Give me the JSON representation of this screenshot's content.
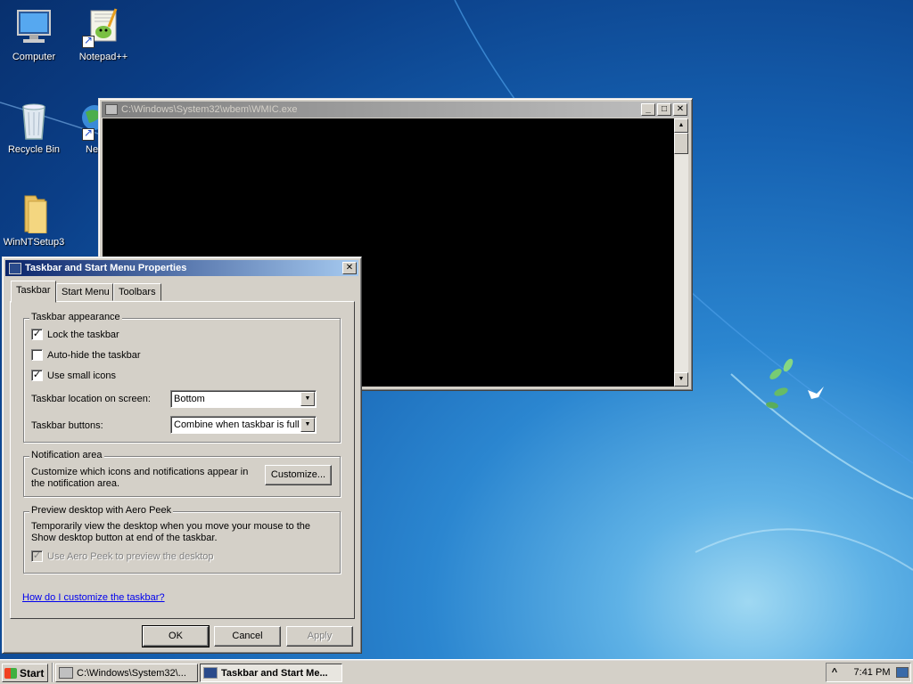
{
  "desktop": {
    "icons": [
      {
        "label": "Computer",
        "icon": "computer-icon"
      },
      {
        "label": "Notepad++",
        "icon": "notepadpp-icon"
      },
      {
        "label": "Recycle Bin",
        "icon": "recycle-bin-icon"
      },
      {
        "label": "Ne",
        "icon": "network-icon"
      },
      {
        "label": "WinNTSetup3",
        "icon": "folder-icon"
      }
    ]
  },
  "console_window": {
    "title": "C:\\Windows\\System32\\wbem\\WMIC.exe",
    "buttons": {
      "minimize": "_",
      "maximize": "□",
      "close": "✕"
    }
  },
  "dialog": {
    "title": "Taskbar and Start Menu Properties",
    "close": "✕",
    "tabs": [
      {
        "label": "Taskbar",
        "selected": true
      },
      {
        "label": "Start Menu",
        "selected": false
      },
      {
        "label": "Toolbars",
        "selected": false
      }
    ],
    "appearance": {
      "legend": "Taskbar appearance",
      "lock": {
        "label": "Lock the taskbar",
        "checked": true
      },
      "autohide": {
        "label": "Auto-hide the taskbar",
        "checked": false
      },
      "small_icons": {
        "label": "Use small icons",
        "checked": true
      },
      "location_label": "Taskbar location on screen:",
      "location_value": "Bottom",
      "buttons_label": "Taskbar buttons:",
      "buttons_value": "Combine when taskbar is full"
    },
    "notification": {
      "legend": "Notification area",
      "text": "Customize which icons and notifications appear in the notification area.",
      "button": "Customize..."
    },
    "peek": {
      "legend": "Preview desktop with Aero Peek",
      "text": "Temporarily view the desktop when you move your mouse to the Show desktop button at end of the taskbar.",
      "checkbox": {
        "label": "Use Aero Peek to preview the desktop",
        "checked": true,
        "disabled": true
      }
    },
    "help_link": "How do I customize the taskbar?",
    "ok": "OK",
    "cancel": "Cancel",
    "apply": "Apply"
  },
  "taskbar": {
    "start": "Start",
    "tasks": [
      {
        "label": "C:\\Windows\\System32\\...",
        "active": false
      },
      {
        "label": "Taskbar and Start Me...",
        "active": true
      }
    ],
    "tray_arrow": "^",
    "clock": "7:41 PM"
  }
}
